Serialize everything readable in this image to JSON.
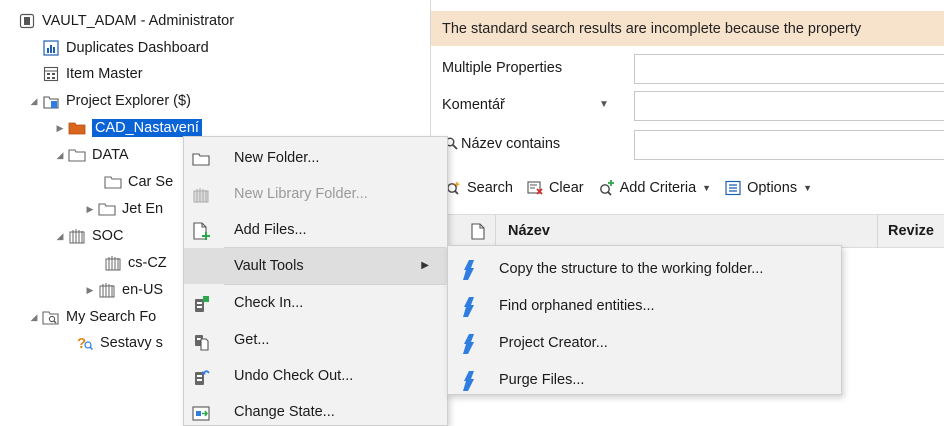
{
  "tree": {
    "root_label": "VAULT_ADAM - Administrator",
    "duplicates_label": "Duplicates Dashboard",
    "item_master_label": "Item Master",
    "project_explorer_label": "Project Explorer ($)",
    "cad_folder_label": "CAD_Nastavení",
    "data_folder_label": "DATA",
    "car_folder_label": "Car Se",
    "jet_folder_label": "Jet En",
    "soc_folder_label": "SOC",
    "cs_folder_label": "cs-CZ",
    "en_folder_label": "en-US",
    "my_search_label": "My Search Fo",
    "sestavy_label": "Sestavy s"
  },
  "right": {
    "banner_text": "The standard search results are incomplete because the property",
    "criteria": [
      {
        "label": "Multiple Properties"
      },
      {
        "label": "Komentář"
      },
      {
        "label": "Název contains"
      }
    ],
    "toolbar": {
      "search_label": "Search",
      "clear_label": "Clear",
      "add_criteria_label": "Add Criteria",
      "options_label": "Options"
    },
    "columns": {
      "name_label": "Název",
      "revision_label": "Revize"
    }
  },
  "context_menu": {
    "items": [
      {
        "label": "New Folder...",
        "icon": "folder-icon",
        "enabled": true
      },
      {
        "label": "New Library Folder...",
        "icon": "library-folder-icon",
        "enabled": false
      },
      {
        "label": "Add Files...",
        "icon": "add-file-icon",
        "enabled": true
      },
      {
        "label": "Vault Tools",
        "icon": "",
        "enabled": true,
        "submenu": true,
        "highlighted": true
      },
      {
        "label": "Check In...",
        "icon": "check-in-icon",
        "enabled": true
      },
      {
        "label": "Get...",
        "icon": "get-icon",
        "enabled": true
      },
      {
        "label": "Undo Check Out...",
        "icon": "undo-check-out-icon",
        "enabled": true
      },
      {
        "label": "Change State...",
        "icon": "change-state-icon",
        "enabled": true
      }
    ]
  },
  "submenu": {
    "items": [
      {
        "label": "Copy the structure to the working folder...",
        "icon": "vault-tool-icon"
      },
      {
        "label": "Find orphaned entities...",
        "icon": "vault-tool-icon"
      },
      {
        "label": "Project Creator...",
        "icon": "vault-tool-icon"
      },
      {
        "label": "Purge Files...",
        "icon": "vault-tool-icon"
      }
    ]
  },
  "colors": {
    "selection": "#0a64d6",
    "banner_bg": "#f7e3cc",
    "menu_bg": "#f2f2f2",
    "menu_hover": "#dedede",
    "cad_folder": "#d9641e",
    "vault_tool_blue": "#2f7de1"
  }
}
